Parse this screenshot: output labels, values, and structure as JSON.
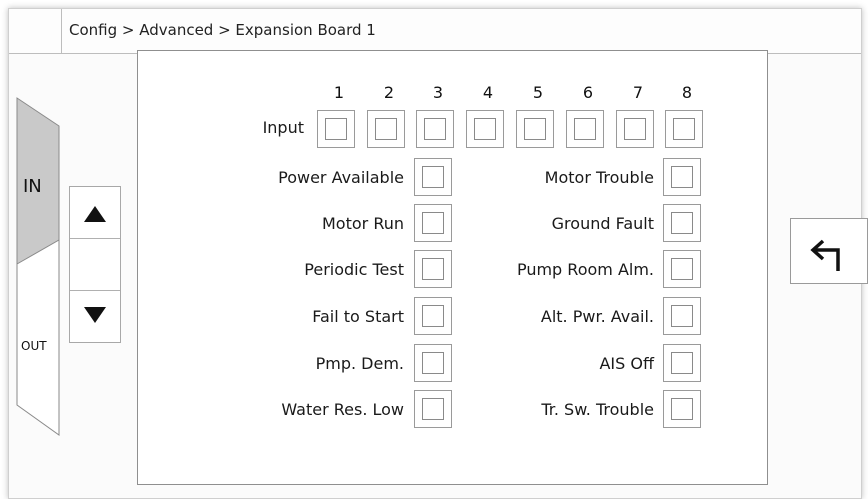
{
  "breadcrumb": "Config > Advanced > Expansion Board 1",
  "tabs": {
    "in_label": "IN",
    "out_label": "OUT"
  },
  "scroll": {
    "up_icon": "triangle-up-icon",
    "down_icon": "triangle-down-icon"
  },
  "inputs": {
    "row_label": "Input",
    "numbers": [
      "1",
      "2",
      "3",
      "4",
      "5",
      "6",
      "7",
      "8"
    ]
  },
  "left_column": [
    "Power Available",
    "Motor Run",
    "Periodic Test",
    "Fail to Start",
    "Pmp. Dem.",
    "Water Res. Low"
  ],
  "right_column": [
    "Motor Trouble",
    "Ground Fault",
    "Pump Room Alm.",
    "Alt. Pwr. Avail.",
    "AIS Off",
    "Tr. Sw. Trouble"
  ],
  "back_button": {
    "icon": "return-arrow-icon"
  },
  "colors": {
    "active_tab": "#c9c9c9",
    "inactive_tab": "#ffffff",
    "border": "#8f8f8f"
  }
}
